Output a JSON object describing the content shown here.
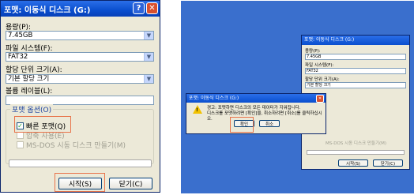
{
  "dialog": {
    "title": "포맷: 이동식 디스크 (G:)",
    "help_glyph": "?",
    "close_glyph": "✕",
    "capacity_label": "용량(P):",
    "capacity_value": "7.45GB",
    "filesystem_label": "파일 시스템(F):",
    "filesystem_value": "FAT32",
    "alloc_label": "할당 단위 크기(A):",
    "alloc_value": "기본 할당 크기",
    "volume_label": "볼륨 레이블(L):",
    "volume_value": "",
    "options_title": "포맷 옵션(O)",
    "quick_format": "빠른 포맷(Q)",
    "compress": "압축 사용(E)",
    "msdos": "MS-DOS 시동 디스크 만들기(M)",
    "quick_format_checked": true,
    "start_button": "시작(S)",
    "close_button": "닫기(C)",
    "highlight_color": "#e8734a"
  },
  "screenshot": {
    "dialog_title": "포맷: 이동식 디스크 (G:)",
    "capacity_label": "용량(P):",
    "capacity_value": "7.45GB",
    "filesystem_label": "파일 시스템(F):",
    "filesystem_value": "FAT32",
    "alloc_label": "할당 단위 크기(A):",
    "alloc_value": "기본 할당 크기",
    "msdos": "MS-DOS 시동 디스크 만들기(M)",
    "start_button": "시작(S)",
    "close_button": "닫기(C)",
    "warning_title": "포맷: 이동식 디스크 (G:)",
    "warning_line1": "경고: 포맷하면 디스크의 모든 데이터가 지워집니다.",
    "warning_line2": "디스크를 포맷하려면 [확인]을, 취소하려면 [취소]를 클릭하십시오.",
    "ok_button": "확인",
    "cancel_button": "취소"
  }
}
